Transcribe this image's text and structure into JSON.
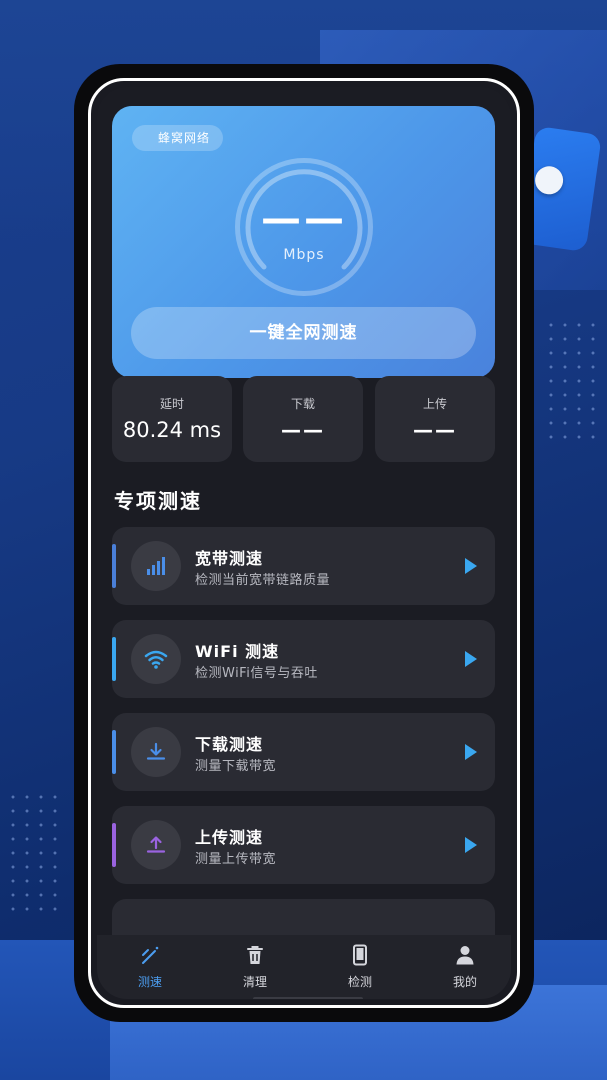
{
  "hero": {
    "tag": "蜂窝网络",
    "speed_value": "——",
    "speed_unit": "Mbps",
    "test_button": "一键全网测速"
  },
  "stats": [
    {
      "label": "延时",
      "value": "80.24 ms"
    },
    {
      "label": "下载",
      "value": "——"
    },
    {
      "label": "上传",
      "value": "——"
    }
  ],
  "section_title": "专项测速",
  "items": [
    {
      "title": "宽带测速",
      "subtitle": "检测当前宽带链路质量",
      "icon": "signal-bars-icon",
      "accent": "#4a7fd8"
    },
    {
      "title": "WiFi 测速",
      "subtitle": "检测WiFi信号与吞吐",
      "icon": "wifi-icon",
      "accent": "#3aa7f0"
    },
    {
      "title": "下载测速",
      "subtitle": "测量下载带宽",
      "icon": "download-icon",
      "accent": "#4a8ee8"
    },
    {
      "title": "上传测速",
      "subtitle": "测量上传带宽",
      "icon": "upload-icon",
      "accent": "#9a63e0"
    }
  ],
  "tabs": [
    {
      "label": "测速",
      "icon": "speed-wand-icon",
      "active": true
    },
    {
      "label": "清理",
      "icon": "trash-icon",
      "active": false
    },
    {
      "label": "检测",
      "icon": "phone-icon",
      "active": false
    },
    {
      "label": "我的",
      "icon": "person-icon",
      "active": false
    }
  ],
  "colors": {
    "accent": "#3aa7f0",
    "card": "#2a2b33",
    "screen_bg": "#1b1c23"
  }
}
